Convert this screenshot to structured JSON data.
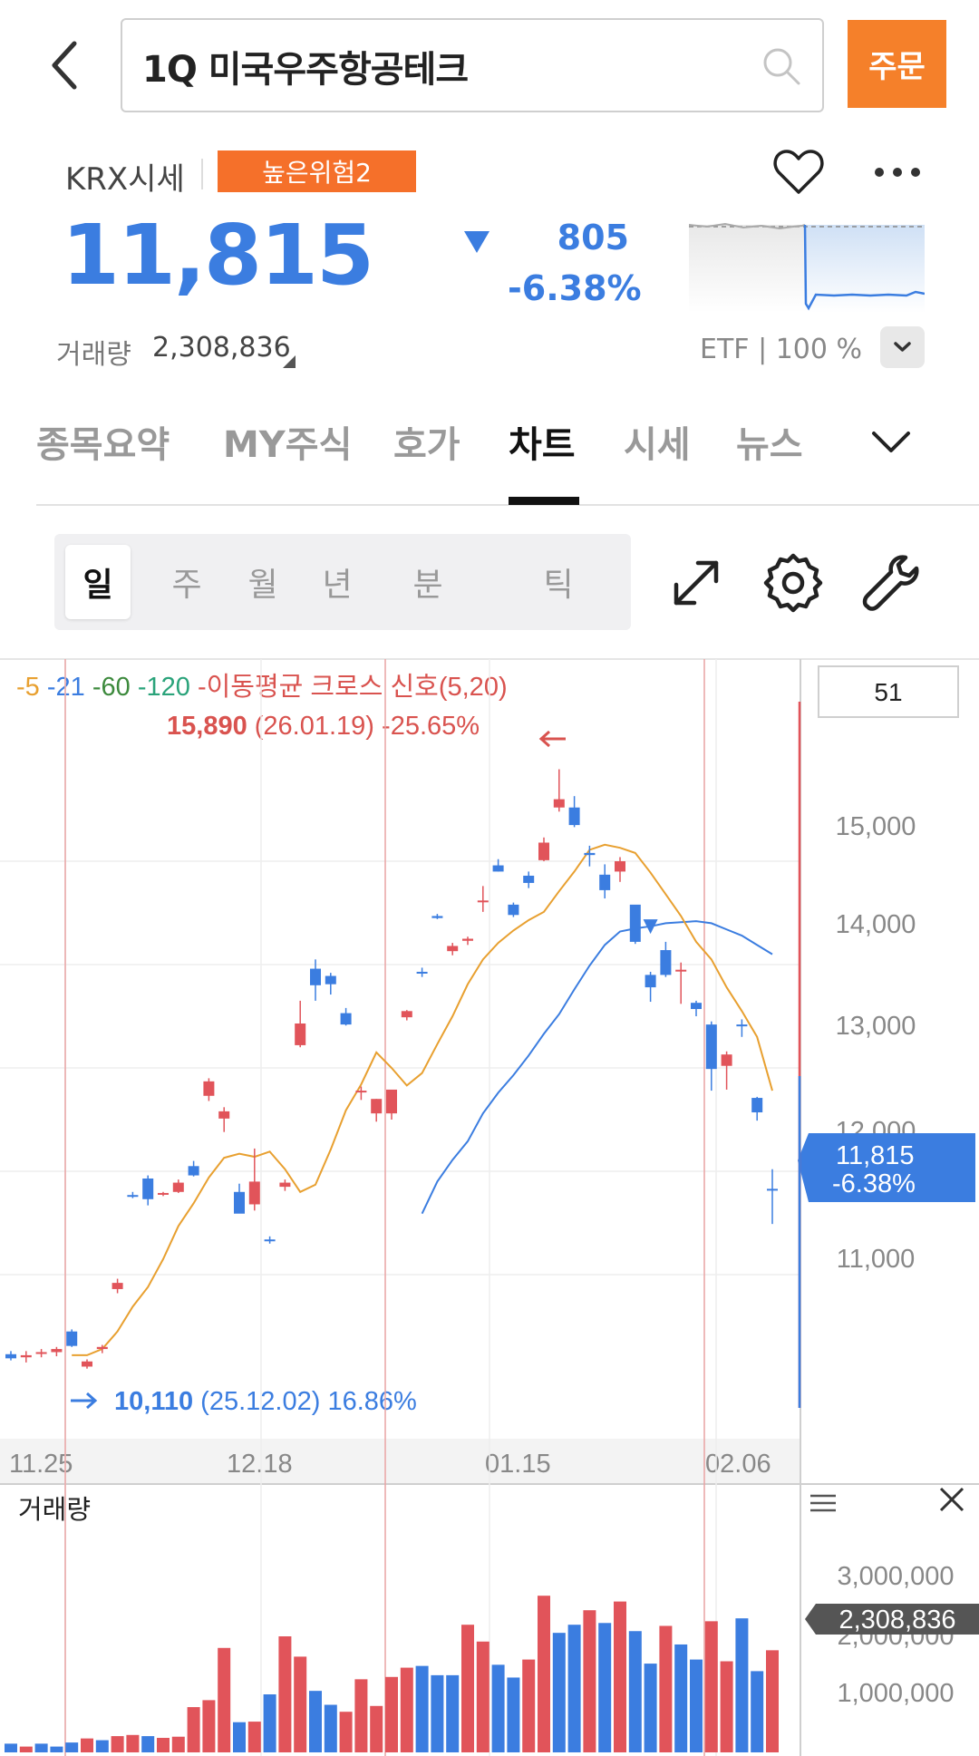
{
  "header": {
    "title": "1Q 미국우주항공테크",
    "order_label": "주문"
  },
  "quote": {
    "market": "KRX시세",
    "risk_badge": "높은위험2",
    "price": "11,815",
    "change": "805",
    "change_pct": "-6.38%",
    "volume_label": "거래량",
    "volume": "2,308,836",
    "etf_info": "ETF | 100 %"
  },
  "tabs": [
    "종목요약",
    "MY주식",
    "호가",
    "차트",
    "시세",
    "뉴스"
  ],
  "active_tab": "차트",
  "periods": [
    "일",
    "주",
    "월",
    "년",
    "분",
    "틱"
  ],
  "active_period": "일",
  "colors": {
    "up": "#e1545a",
    "down": "#3b7de0",
    "ma5": "#e8a030",
    "ma21": "#3b7de0",
    "ma60": "#3d8a3d",
    "ma120": "#2aa37a",
    "accent": "#f5802a"
  },
  "chart_data": {
    "type": "candlestick",
    "legend": {
      "ma5": "5",
      "ma21": "21",
      "ma60": "60",
      "ma120": "120",
      "signal": "이동평균 크로스 신호(5,20)"
    },
    "count_box": "51",
    "high_annotation": {
      "price": "15,890",
      "date": "(26.01.19)",
      "pct": "-25.65%"
    },
    "low_annotation": {
      "price": "10,110",
      "date": "(25.12.02)",
      "pct": "16.86%"
    },
    "y_ticks": [
      "15,000",
      "14,000",
      "13,000",
      "12,000",
      "11,000"
    ],
    "x_ticks": [
      "11.25",
      "12.18",
      "01.15",
      "02.06"
    ],
    "current_label": {
      "price": "11,815",
      "pct": "-6.38%"
    },
    "ylim": [
      9850,
      16300
    ],
    "candles": [
      {
        "o": 10230,
        "h": 10260,
        "l": 10170,
        "c": 10190
      },
      {
        "o": 10200,
        "h": 10260,
        "l": 10150,
        "c": 10220
      },
      {
        "o": 10240,
        "h": 10280,
        "l": 10200,
        "c": 10250
      },
      {
        "o": 10250,
        "h": 10300,
        "l": 10210,
        "c": 10280
      },
      {
        "o": 10450,
        "h": 10470,
        "l": 10300,
        "c": 10310
      },
      {
        "o": 10110,
        "h": 10180,
        "l": 10090,
        "c": 10160
      },
      {
        "o": 10280,
        "h": 10320,
        "l": 10240,
        "c": 10300
      },
      {
        "o": 10860,
        "h": 10960,
        "l": 10820,
        "c": 10920
      },
      {
        "o": 11770,
        "h": 11800,
        "l": 11740,
        "c": 11760
      },
      {
        "o": 11930,
        "h": 11960,
        "l": 11670,
        "c": 11730
      },
      {
        "o": 11780,
        "h": 11800,
        "l": 11760,
        "c": 11790
      },
      {
        "o": 11800,
        "h": 11920,
        "l": 11790,
        "c": 11890
      },
      {
        "o": 12050,
        "h": 12100,
        "l": 11950,
        "c": 11960
      },
      {
        "o": 12730,
        "h": 12900,
        "l": 12680,
        "c": 12870
      },
      {
        "o": 12510,
        "h": 12620,
        "l": 12380,
        "c": 12580
      },
      {
        "o": 11800,
        "h": 11880,
        "l": 11630,
        "c": 11590
      },
      {
        "o": 11680,
        "h": 12220,
        "l": 11620,
        "c": 11900
      },
      {
        "o": 11340,
        "h": 11370,
        "l": 11300,
        "c": 11330
      },
      {
        "o": 11850,
        "h": 11920,
        "l": 11810,
        "c": 11890
      },
      {
        "o": 13220,
        "h": 13650,
        "l": 13200,
        "c": 13430
      },
      {
        "o": 13960,
        "h": 14050,
        "l": 13650,
        "c": 13800
      },
      {
        "o": 13890,
        "h": 13920,
        "l": 13710,
        "c": 13810
      },
      {
        "o": 13530,
        "h": 13580,
        "l": 13410,
        "c": 13420
      },
      {
        "o": 12770,
        "h": 12820,
        "l": 12690,
        "c": 12780
      },
      {
        "o": 12560,
        "h": 12700,
        "l": 12480,
        "c": 12700
      },
      {
        "o": 12560,
        "h": 12750,
        "l": 12500,
        "c": 12790
      },
      {
        "o": 13490,
        "h": 13560,
        "l": 13460,
        "c": 13550
      },
      {
        "o": 13930,
        "h": 13970,
        "l": 13880,
        "c": 13920
      },
      {
        "o": 14470,
        "h": 14490,
        "l": 14440,
        "c": 14450
      },
      {
        "o": 14130,
        "h": 14210,
        "l": 14090,
        "c": 14180
      },
      {
        "o": 14230,
        "h": 14270,
        "l": 14190,
        "c": 14250
      },
      {
        "o": 14620,
        "h": 14760,
        "l": 14510,
        "c": 14620
      },
      {
        "o": 14960,
        "h": 15020,
        "l": 14900,
        "c": 14900
      },
      {
        "o": 14580,
        "h": 14600,
        "l": 14460,
        "c": 14480
      },
      {
        "o": 14860,
        "h": 14900,
        "l": 14740,
        "c": 14790
      },
      {
        "o": 15010,
        "h": 15230,
        "l": 15000,
        "c": 15180
      },
      {
        "o": 15520,
        "h": 15890,
        "l": 15480,
        "c": 15600
      },
      {
        "o": 15520,
        "h": 15630,
        "l": 15330,
        "c": 15350
      },
      {
        "o": 15080,
        "h": 15150,
        "l": 14950,
        "c": 15060
      },
      {
        "o": 14870,
        "h": 14970,
        "l": 14640,
        "c": 14720
      },
      {
        "o": 14900,
        "h": 15040,
        "l": 14800,
        "c": 15000
      },
      {
        "o": 14580,
        "h": 14560,
        "l": 14200,
        "c": 14220
      },
      {
        "o": 13900,
        "h": 13930,
        "l": 13640,
        "c": 13780
      },
      {
        "o": 14140,
        "h": 14220,
        "l": 13880,
        "c": 13900
      },
      {
        "o": 13940,
        "h": 14020,
        "l": 13620,
        "c": 13950
      },
      {
        "o": 13630,
        "h": 13650,
        "l": 13500,
        "c": 13570
      },
      {
        "o": 13420,
        "h": 13450,
        "l": 12780,
        "c": 12990
      },
      {
        "o": 13020,
        "h": 13160,
        "l": 12790,
        "c": 13130
      },
      {
        "o": 13420,
        "h": 13470,
        "l": 13300,
        "c": 13410
      },
      {
        "o": 12710,
        "h": 12720,
        "l": 12490,
        "c": 12570
      },
      {
        "o": 11830,
        "h": 12020,
        "l": 11490,
        "c": 11815
      }
    ],
    "ma5": [
      null,
      null,
      null,
      null,
      10220,
      10220,
      10280,
      10450,
      10690,
      10880,
      11150,
      11470,
      11690,
      11940,
      12130,
      12170,
      12140,
      12190,
      12020,
      11800,
      11870,
      12210,
      12590,
      12840,
      13150,
      13000,
      12830,
      12950,
      13230,
      13500,
      13810,
      14050,
      14210,
      14330,
      14430,
      14510,
      14710,
      14900,
      15110,
      15160,
      15130,
      15080,
      14890,
      14680,
      14470,
      14220,
      14050,
      13780,
      13550,
      13300,
      12780
    ],
    "ma21": [
      null,
      null,
      null,
      null,
      null,
      null,
      null,
      null,
      null,
      null,
      null,
      null,
      null,
      null,
      null,
      null,
      null,
      null,
      null,
      null,
      null,
      null,
      null,
      null,
      null,
      null,
      null,
      11590,
      11900,
      12110,
      12290,
      12560,
      12760,
      12930,
      13120,
      13330,
      13520,
      13760,
      13990,
      14190,
      14320,
      14350,
      14370,
      14400,
      14410,
      14420,
      14400,
      14340,
      14280,
      14190,
      14100
    ],
    "volume": {
      "y_ticks": [
        "3,000,000",
        "2,000,000",
        "1,000,000"
      ],
      "current": "2,308,836",
      "ylim": [
        0,
        3600000
      ],
      "values": [
        150000,
        100000,
        150000,
        100000,
        170000,
        240000,
        210000,
        280000,
        300000,
        280000,
        250000,
        270000,
        780000,
        900000,
        1800000,
        520000,
        530000,
        1000000,
        2000000,
        1650000,
        1060000,
        820000,
        700000,
        1260000,
        800000,
        1300000,
        1460000,
        1490000,
        1330000,
        1330000,
        2200000,
        1910000,
        1510000,
        1290000,
        1600000,
        2700000,
        2060000,
        2200000,
        2450000,
        2230000,
        2600000,
        2090000,
        1530000,
        2180000,
        1860000,
        1600000,
        2260000,
        1570000,
        2310000,
        1400000,
        1760000
      ],
      "colors": [
        "down",
        "up",
        "down",
        "down",
        "down",
        "up",
        "down",
        "up",
        "up",
        "down",
        "up",
        "up",
        "up",
        "up",
        "up",
        "down",
        "up",
        "down",
        "up",
        "up",
        "down",
        "down",
        "up",
        "up",
        "up",
        "up",
        "up",
        "down",
        "down",
        "down",
        "up",
        "up",
        "down",
        "down",
        "up",
        "up",
        "down",
        "down",
        "up",
        "down",
        "up",
        "down",
        "down",
        "up",
        "down",
        "down",
        "up",
        "up",
        "down",
        "down",
        "up"
      ]
    },
    "volume_label": "거래량"
  }
}
